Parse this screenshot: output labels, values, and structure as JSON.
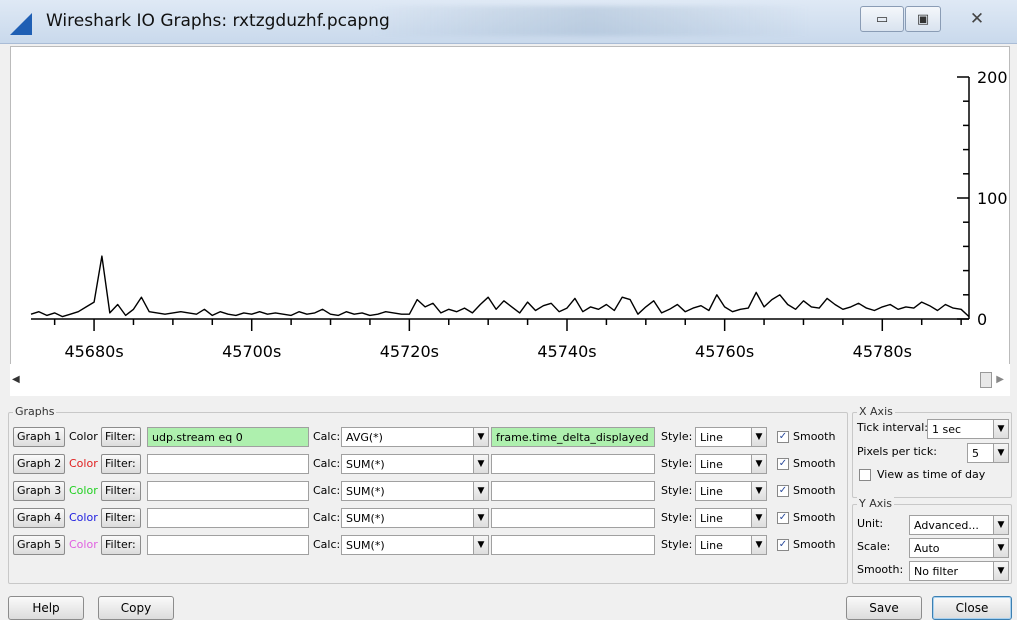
{
  "window": {
    "title": "Wireshark IO Graphs: rxtzgduzhf.pcapng",
    "minimize_symbol": "▭",
    "maximize_symbol": "▣",
    "close_symbol": "✕"
  },
  "chart_data": {
    "type": "line",
    "title": "",
    "xlabel": "",
    "ylabel": "",
    "x_tick_labels": [
      "45680s",
      "45700s",
      "45720s",
      "45740s",
      "45760s",
      "45780s"
    ],
    "x_tick_values": [
      45680,
      45700,
      45720,
      45740,
      45760,
      45780
    ],
    "y_tick_labels": [
      "0",
      "100",
      "200"
    ],
    "xlim": [
      45672,
      45791
    ],
    "ylim": [
      0,
      200
    ],
    "y_axis_side": "right",
    "grid": false,
    "series": [
      {
        "values": [
          4,
          6,
          3,
          5,
          2,
          4,
          6,
          10,
          14,
          52,
          5,
          12,
          3,
          8,
          18,
          6,
          5,
          4,
          5,
          6,
          5,
          4,
          8,
          3,
          6,
          4,
          3,
          5,
          4,
          6,
          4,
          5,
          4,
          3,
          6,
          4,
          5,
          8,
          4,
          3,
          6,
          4,
          5,
          3,
          4,
          6,
          5,
          4,
          4,
          16,
          10,
          13,
          5,
          8,
          6,
          9,
          5,
          12,
          18,
          8,
          15,
          10,
          5,
          14,
          7,
          11,
          13,
          6,
          9,
          17,
          6,
          10,
          8,
          12,
          7,
          18,
          16,
          4,
          10,
          15,
          5,
          8,
          12,
          6,
          9,
          11,
          7,
          20,
          10,
          6,
          8,
          9,
          22,
          10,
          16,
          20,
          12,
          8,
          15,
          10,
          9,
          17,
          12,
          8,
          10,
          13,
          9,
          7,
          10,
          12,
          8,
          10,
          9,
          14,
          11,
          7,
          12,
          9,
          8,
          2
        ],
        "x_start": 45672,
        "x_step": 1,
        "color": "#000000"
      }
    ]
  },
  "scrollbar": {
    "left_arrow": "◀",
    "right_arrow": "▶"
  },
  "graphs_panel": {
    "title": "Graphs",
    "color_label": "Color",
    "filter_label": "Filter:",
    "calc_label": "Calc:",
    "style_label": "Style:",
    "smooth_label": "Smooth",
    "rows": [
      {
        "button": "Graph 1",
        "color": "#000000",
        "filter": "udp.stream eq 0",
        "calc": "AVG(*)",
        "field": "frame.time_delta_displayed",
        "style": "Line",
        "smooth": true
      },
      {
        "button": "Graph 2",
        "color": "#e02020",
        "filter": "",
        "calc": "SUM(*)",
        "field": "",
        "style": "Line",
        "smooth": true
      },
      {
        "button": "Graph 3",
        "color": "#20d020",
        "filter": "",
        "calc": "SUM(*)",
        "field": "",
        "style": "Line",
        "smooth": true
      },
      {
        "button": "Graph 4",
        "color": "#2020e0",
        "filter": "",
        "calc": "SUM(*)",
        "field": "",
        "style": "Line",
        "smooth": true
      },
      {
        "button": "Graph 5",
        "color": "#e060e0",
        "filter": "",
        "calc": "SUM(*)",
        "field": "",
        "style": "Line",
        "smooth": true
      }
    ]
  },
  "x_axis_panel": {
    "title": "X Axis",
    "tick_interval_label": "Tick interval:",
    "tick_interval_value": "1 sec",
    "pixels_per_tick_label": "Pixels per tick:",
    "pixels_per_tick_value": "5",
    "view_time_of_day_label": "View as time of day",
    "view_time_of_day": false
  },
  "y_axis_panel": {
    "title": "Y Axis",
    "unit_label": "Unit:",
    "unit_value": "Advanced...",
    "scale_label": "Scale:",
    "scale_value": "Auto",
    "smooth_label": "Smooth:",
    "smooth_value": "No filter"
  },
  "buttons": {
    "help": "Help",
    "copy": "Copy",
    "save": "Save",
    "close": "Close"
  }
}
